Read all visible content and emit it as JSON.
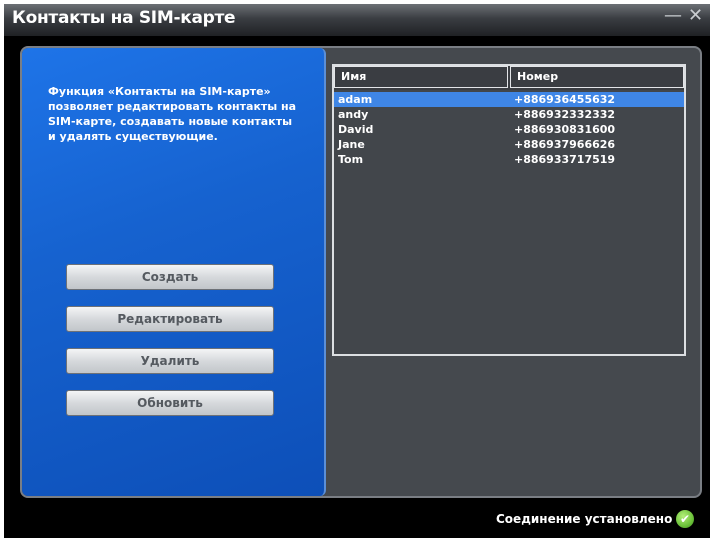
{
  "window": {
    "title": "Контакты на SIM-карте",
    "minimize_glyph": "—",
    "close_glyph": "✕"
  },
  "left_panel": {
    "description": "Функция «Контакты на SIM-карте» позволяет редактировать контакты на SIM-карте, создавать новые контакты и удалять существующие.",
    "buttons": {
      "create": "Создать",
      "edit": "Редактировать",
      "delete": "Удалить",
      "refresh": "Обновить"
    }
  },
  "contacts_table": {
    "columns": [
      "Имя",
      "Номер"
    ],
    "rows": [
      {
        "name": "adam",
        "number": "+886936455632",
        "selected": true
      },
      {
        "name": "andy",
        "number": "+886932332332",
        "selected": false
      },
      {
        "name": "David",
        "number": "+886930831600",
        "selected": false
      },
      {
        "name": "Jane",
        "number": "+886937966626",
        "selected": false
      },
      {
        "name": "Tom",
        "number": "+886933717519",
        "selected": false
      }
    ]
  },
  "status": {
    "text": "Соединение установлено",
    "icon": "check-circle-icon",
    "icon_glyph": "✔",
    "icon_color": "#6cc23a"
  },
  "colors": {
    "panel_blue": "#1662cf",
    "selection": "#3f86e6",
    "background_dark": "#45494e"
  }
}
